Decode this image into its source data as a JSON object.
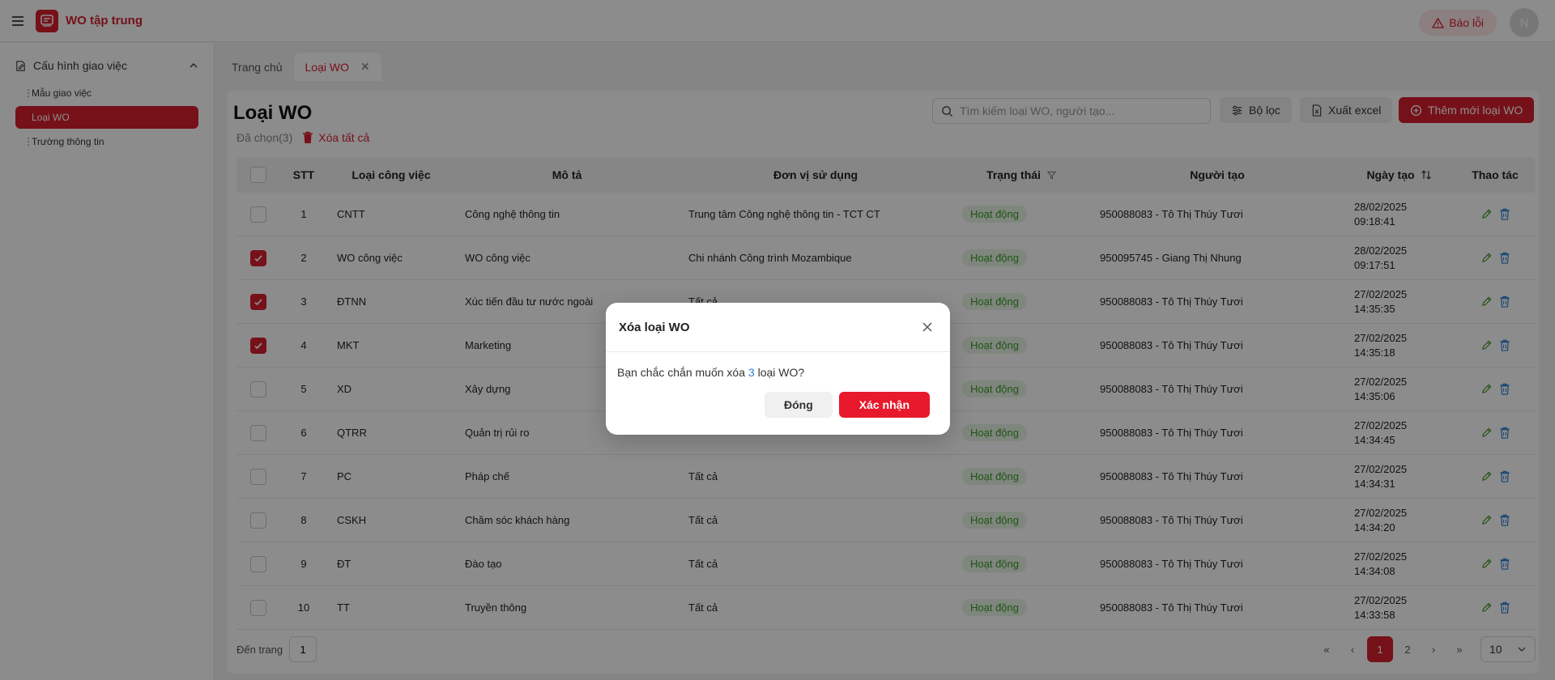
{
  "app": {
    "title": "WO tập trung",
    "report_label": "Báo lỗi",
    "avatar_initial": "N",
    "accent": "#d71f2f"
  },
  "sidebar": {
    "group_label": "Cấu hình giao việc",
    "items": [
      {
        "label": "Mẫu giao việc"
      },
      {
        "label": "Loại WO"
      },
      {
        "label": "Trường thông tin"
      }
    ]
  },
  "tabs": [
    {
      "label": "Trang chủ"
    },
    {
      "label": "Loại WO"
    }
  ],
  "page": {
    "title": "Loại WO",
    "search_placeholder": "Tìm kiếm loại WO, người tạo...",
    "filter_label": "Bộ lọc",
    "excel_label": "Xuất excel",
    "add_label": "Thêm mới loại WO",
    "selected_label": "Đã chọn(3)",
    "delete_all_label": "Xóa tất cả"
  },
  "table": {
    "headers": {
      "stt": "STT",
      "type": "Loại công việc",
      "desc": "Mô tả",
      "unit": "Đơn vị sử dụng",
      "status": "Trạng thái",
      "creator": "Người tạo",
      "date": "Ngày tạo",
      "action": "Thao tác"
    },
    "rows": [
      {
        "checked": false,
        "stt": "1",
        "type": "CNTT",
        "desc": "Công nghệ thông tin",
        "unit": "Trung tâm Công nghệ thông tin - TCT CT",
        "status": "Hoạt động",
        "creator": "950088083 - Tô Thị Thúy Tươi",
        "date": "28/02/2025",
        "time": "09:18:41"
      },
      {
        "checked": true,
        "stt": "2",
        "type": "WO công việc",
        "desc": "WO công việc",
        "unit": "Chi nhánh Công trình Mozambique",
        "status": "Hoạt động",
        "creator": "950095745 - Giang Thị Nhung",
        "date": "28/02/2025",
        "time": "09:17:51"
      },
      {
        "checked": true,
        "stt": "3",
        "type": "ĐTNN",
        "desc": "Xúc tiến đầu tư nước ngoài",
        "unit": "Tất cả",
        "status": "Hoạt động",
        "creator": "950088083 - Tô Thị Thúy Tươi",
        "date": "27/02/2025",
        "time": "14:35:35"
      },
      {
        "checked": true,
        "stt": "4",
        "type": "MKT",
        "desc": "Marketing",
        "unit": "",
        "status": "Hoạt động",
        "creator": "950088083 - Tô Thị Thúy Tươi",
        "date": "27/02/2025",
        "time": "14:35:18"
      },
      {
        "checked": false,
        "stt": "5",
        "type": "XD",
        "desc": "Xây dựng",
        "unit": "",
        "status": "Hoạt động",
        "creator": "950088083 - Tô Thị Thúy Tươi",
        "date": "27/02/2025",
        "time": "14:35:06"
      },
      {
        "checked": false,
        "stt": "6",
        "type": "QTRR",
        "desc": "Quản trị rủi ro",
        "unit": "",
        "status": "Hoạt động",
        "creator": "950088083 - Tô Thị Thúy Tươi",
        "date": "27/02/2025",
        "time": "14:34:45"
      },
      {
        "checked": false,
        "stt": "7",
        "type": "PC",
        "desc": "Pháp chế",
        "unit": "Tất cả",
        "status": "Hoạt động",
        "creator": "950088083 - Tô Thị Thúy Tươi",
        "date": "27/02/2025",
        "time": "14:34:31"
      },
      {
        "checked": false,
        "stt": "8",
        "type": "CSKH",
        "desc": "Chăm sóc khách hàng",
        "unit": "Tất cả",
        "status": "Hoạt động",
        "creator": "950088083 - Tô Thị Thúy Tươi",
        "date": "27/02/2025",
        "time": "14:34:20"
      },
      {
        "checked": false,
        "stt": "9",
        "type": "ĐT",
        "desc": "Đào tạo",
        "unit": "Tất cả",
        "status": "Hoạt động",
        "creator": "950088083 - Tô Thị Thúy Tươi",
        "date": "27/02/2025",
        "time": "14:34:08"
      },
      {
        "checked": false,
        "stt": "10",
        "type": "TT",
        "desc": "Truyền thông",
        "unit": "Tất cả",
        "status": "Hoạt động",
        "creator": "950088083 - Tô Thị Thúy Tươi",
        "date": "27/02/2025",
        "time": "14:33:58"
      }
    ]
  },
  "pagination": {
    "goto_label": "Đến trang",
    "goto_value": "1",
    "pages": [
      "1",
      "2"
    ],
    "current": "1",
    "page_size": "10"
  },
  "modal": {
    "title": "Xóa loại WO",
    "body_prefix": "Bạn chắc chắn muốn xóa ",
    "body_count": "3",
    "body_suffix": " loại WO?",
    "close_label": "Đóng",
    "confirm_label": "Xác nhận"
  }
}
